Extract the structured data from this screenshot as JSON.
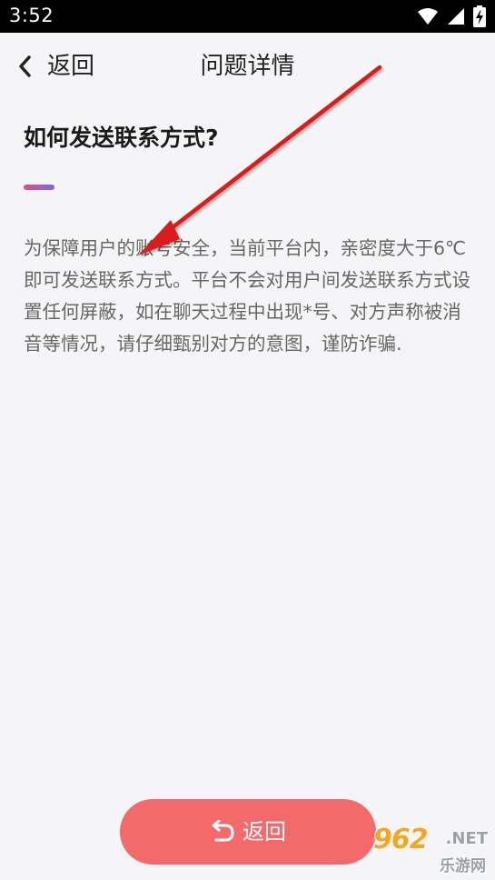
{
  "status_bar": {
    "time": "3:52",
    "icons": [
      "wifi-icon",
      "cellular-signal-icon",
      "battery-charging-icon"
    ]
  },
  "header": {
    "back_label": "返回",
    "title": "问题详情"
  },
  "question": {
    "title": "如何发送联系方式?",
    "answer": "为保障用户的账号安全，当前平台内，亲密度大于6℃即可发送联系方式。平台不会对用户间发送联系方式设置任何屏蔽，如在聊天过程中出现*号、对方声称被消音等情况，请仔细甄别对方的意图，谨防诈骗."
  },
  "footer": {
    "back_button_label": "返回"
  },
  "watermark": {
    "logo": "962",
    "suffix": ".NET",
    "subtitle": "乐游网"
  },
  "colors": {
    "status_bar_bg": "#000000",
    "page_bg": "#f5f5f7",
    "button_bg": "#f36a6a",
    "accent_start": "#e0507a",
    "accent_end": "#7a6ae8",
    "annotation_arrow": "#d91c1c"
  }
}
